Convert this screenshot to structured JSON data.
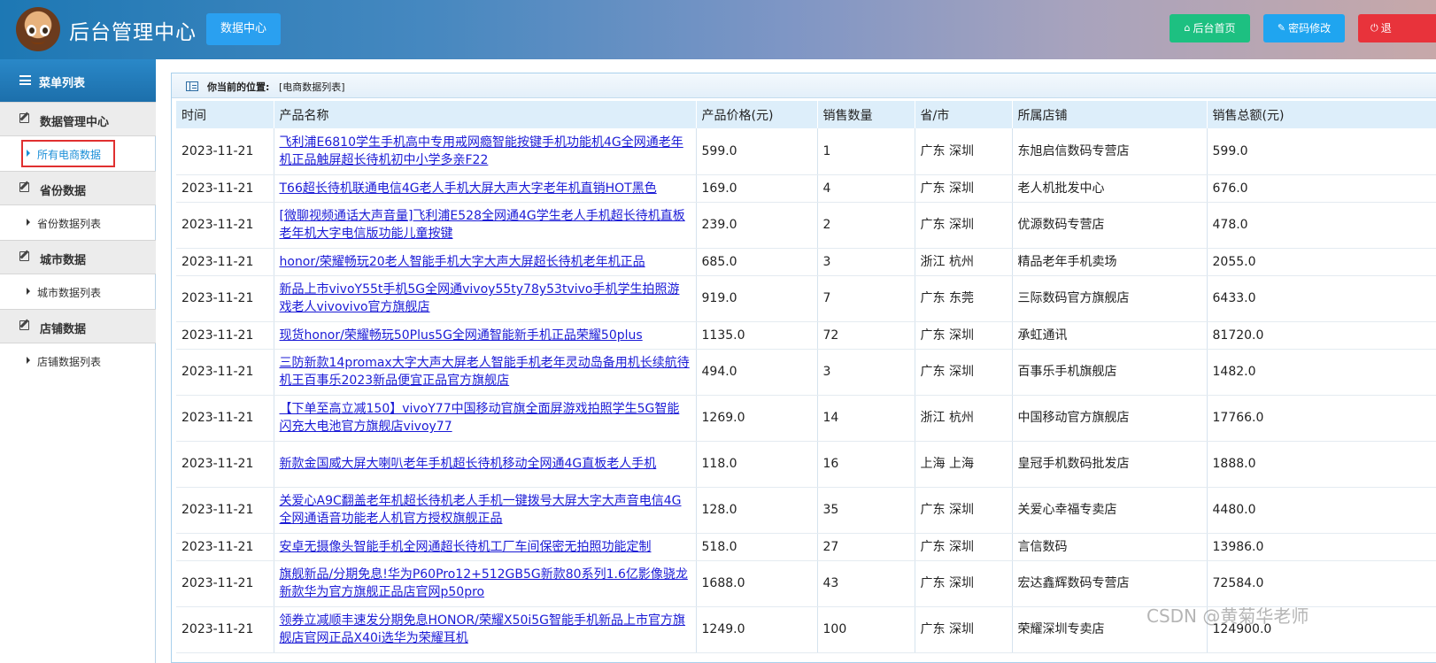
{
  "header": {
    "title": "后台管理中心",
    "nav_button": "数据中心",
    "buttons": {
      "home": "后台首页",
      "password": "密码修改",
      "exit": "退"
    }
  },
  "sidebar": {
    "title": "菜单列表",
    "groups": [
      {
        "label": "数据管理中心",
        "items": [
          "所有电商数据"
        ]
      },
      {
        "label": "省份数据",
        "items": [
          "省份数据列表"
        ]
      },
      {
        "label": "城市数据",
        "items": [
          "城市数据列表"
        ]
      },
      {
        "label": "店铺数据",
        "items": [
          "店铺数据列表"
        ]
      }
    ],
    "active_item": "所有电商数据"
  },
  "breadcrumb": {
    "label": "你当前的位置:",
    "value": "[电商数据列表]"
  },
  "table": {
    "columns": [
      "时间",
      "产品名称",
      "产品价格(元)",
      "销售数量",
      "省/市",
      "所属店铺",
      "销售总额(元)"
    ],
    "rows": [
      {
        "time": "2023-11-21",
        "name": "飞利浦E6810学生手机高中专用戒网瘾智能按键手机功能机4G全网通老年机正品触屏超长待机初中小学多亲F22",
        "price": "599.0",
        "qty": "1",
        "region": "广东 深圳",
        "shop": "东旭启信数码专营店",
        "total": "599.0"
      },
      {
        "time": "2023-11-21",
        "name": "T66超长待机联通电信4G老人手机大屏大声大字老年机直销HOT黑色",
        "price": "169.0",
        "qty": "4",
        "region": "广东 深圳",
        "shop": "老人机批发中心",
        "total": "676.0"
      },
      {
        "time": "2023-11-21",
        "name": "[微聊视频通话大声音量]飞利浦E528全网通4G学生老人手机超长待机直板老年机大字电信版功能儿童按键",
        "price": "239.0",
        "qty": "2",
        "region": "广东 深圳",
        "shop": "优源数码专营店",
        "total": "478.0"
      },
      {
        "time": "2023-11-21",
        "name": "honor/荣耀畅玩20老人智能手机大字大声大屏超长待机老年机正品",
        "price": "685.0",
        "qty": "3",
        "region": "浙江 杭州",
        "shop": "精品老年手机卖场",
        "total": "2055.0"
      },
      {
        "time": "2023-11-21",
        "name": "新品上市vivoY55t手机5G全网通vivoy55ty78y53tvivo手机学生拍照游戏老人vivovivo官方旗舰店",
        "price": "919.0",
        "qty": "7",
        "region": "广东 东莞",
        "shop": "三际数码官方旗舰店",
        "total": "6433.0"
      },
      {
        "time": "2023-11-21",
        "name": "现货honor/荣耀畅玩50Plus5G全网通智能新手机正品荣耀50plus",
        "price": "1135.0",
        "qty": "72",
        "region": "广东 深圳",
        "shop": "承虹通讯",
        "total": "81720.0"
      },
      {
        "time": "2023-11-21",
        "name": "三防新款14promax大字大声大屏老人智能手机老年灵动岛备用机长续航待机王百事乐2023新品便宜正品官方旗舰店",
        "price": "494.0",
        "qty": "3",
        "region": "广东 深圳",
        "shop": "百事乐手机旗舰店",
        "total": "1482.0"
      },
      {
        "time": "2023-11-21",
        "name": "【下单至高立减150】vivoY77中国移动官旗全面屏游戏拍照学生5G智能闪充大电池官方旗舰店vivoy77",
        "price": "1269.0",
        "qty": "14",
        "region": "浙江 杭州",
        "shop": "中国移动官方旗舰店",
        "total": "17766.0"
      },
      {
        "time": "2023-11-21",
        "name": "新款金国威大屏大喇叭老年手机超长待机移动全网通4G直板老人手机",
        "price": "118.0",
        "qty": "16",
        "region": "上海 上海",
        "shop": "皇冠手机数码批发店",
        "total": "1888.0"
      },
      {
        "time": "2023-11-21",
        "name": "关爱心A9C翻盖老年机超长待机老人手机一键拨号大屏大字大声音电信4G全网通语音功能老人机官方授权旗舰正品",
        "price": "128.0",
        "qty": "35",
        "region": "广东 深圳",
        "shop": "关爱心幸福专卖店",
        "total": "4480.0"
      },
      {
        "time": "2023-11-21",
        "name": "安卓无摄像头智能手机全网通超长待机工厂车间保密无拍照功能定制",
        "price": "518.0",
        "qty": "27",
        "region": "广东 深圳",
        "shop": "言信数码",
        "total": "13986.0"
      },
      {
        "time": "2023-11-21",
        "name": "旗舰新品/分期免息!华为P60Pro12+512GB5G新款80系列1.6亿影像骁龙新款华为官方旗舰正品店官网p50pro",
        "price": "1688.0",
        "qty": "43",
        "region": "广东 深圳",
        "shop": "宏达鑫辉数码专营店",
        "total": "72584.0"
      },
      {
        "time": "2023-11-21",
        "name": "领券立减顺丰速发分期免息HONOR/荣耀X50i5G智能手机新品上市官方旗舰店官网正品X40i选华为荣耀耳机",
        "price": "1249.0",
        "qty": "100",
        "region": "广东 深圳",
        "shop": "荣耀深圳专卖店",
        "total": "124900.0"
      }
    ]
  },
  "watermark": "CSDN @黄菊华老师"
}
